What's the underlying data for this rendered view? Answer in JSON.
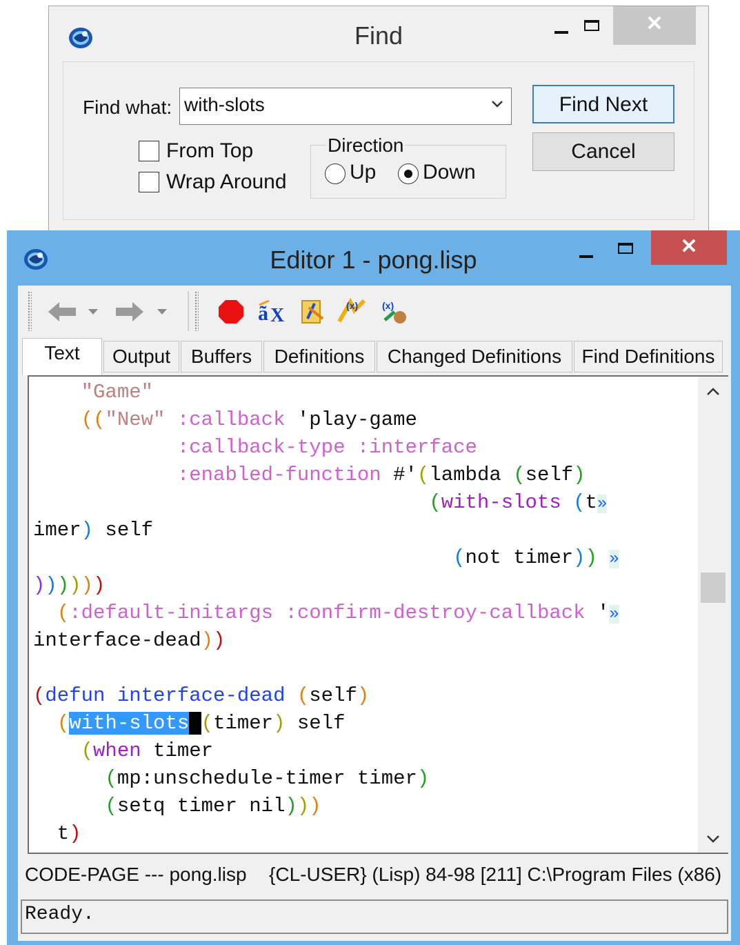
{
  "find_dialog": {
    "title": "Find",
    "find_what_label": "Find what:",
    "find_what_value": "with-slots",
    "from_top_label": "From Top",
    "from_top_checked": false,
    "wrap_around_label": "Wrap Around",
    "wrap_around_checked": false,
    "direction_label": "Direction",
    "up_label": "Up",
    "down_label": "Down",
    "direction_selected": "Down",
    "find_next_label": "Find Next",
    "cancel_label": "Cancel"
  },
  "editor": {
    "title": "Editor 1 - pong.lisp",
    "tabs": [
      "Text",
      "Output",
      "Buffers",
      "Definitions",
      "Changed Definitions",
      "Find Definitions"
    ],
    "active_tab": "Text",
    "code_lines": [
      "    \"Game\"",
      "    ((\"New\" :callback 'play-game",
      "            :callback-type :interface",
      "            :enabled-function #'(lambda (self)",
      "                                 (with-slots (t »",
      "imer) self",
      "                                   (not timer)) »",
      "))))))",
      "  (:default-initargs :confirm-destroy-callback '»",
      "interface-dead))",
      "",
      "(defun interface-dead (self)",
      "  (with-slots (timer) self",
      "    (when timer",
      "      (mp:unschedule-timer timer)",
      "      (setq timer nil)))",
      "  t)"
    ],
    "selected_text": "with-slots",
    "mode_line_buffer": "CODE-PAGE --- pong.lisp",
    "mode_line_info": "{CL-USER} (Lisp) 84-98 [211] C:\\Program Files (x86)",
    "echo_area": "Ready."
  },
  "colors": {
    "editor_frame": "#6bb0e6",
    "close_button": "#c75050",
    "selection": "#3399ff",
    "string": "#c08080",
    "keyword": "#d060d0"
  }
}
